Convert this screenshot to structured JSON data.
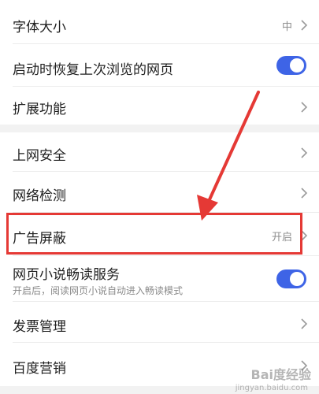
{
  "settings": {
    "font_size": {
      "label": "字体大小",
      "value": "中"
    },
    "restore_pages": {
      "label": "启动时恢复上次浏览的网页",
      "enabled": true
    },
    "extensions": {
      "label": "扩展功能"
    },
    "web_security": {
      "label": "上网安全"
    },
    "network_check": {
      "label": "网络检测"
    },
    "ad_block": {
      "label": "广告屏蔽",
      "value": "开启"
    },
    "novel_reader": {
      "label": "网页小说畅读服务",
      "description": "开启后，阅读网页小说自动进入畅读模式",
      "enabled": true
    },
    "invoice": {
      "label": "发票管理"
    },
    "baidu_marketing": {
      "label": "百度营销"
    }
  },
  "annotation": {
    "color": "#e53935"
  },
  "watermark": {
    "text": "Bai度经验",
    "sub": "jingyan.baidu.com"
  },
  "colors": {
    "toggle_on": "#3e64e6"
  }
}
